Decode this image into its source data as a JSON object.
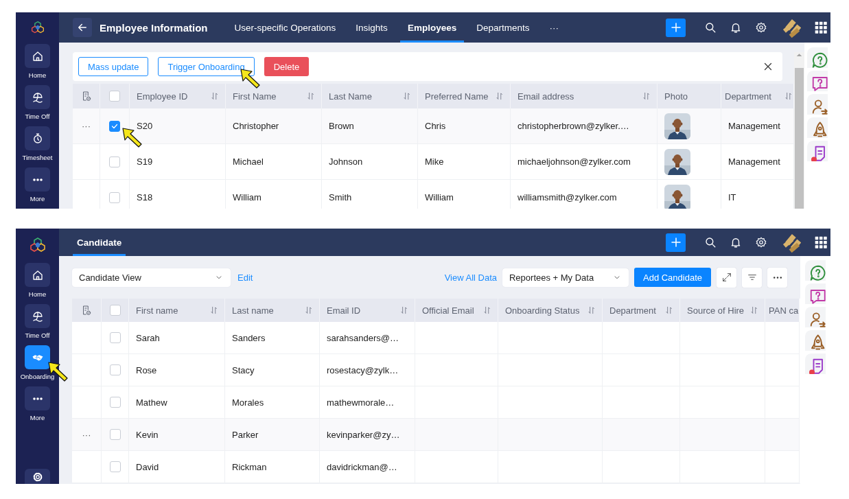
{
  "screens": [
    {
      "sidebar": {
        "items": [
          {
            "kind": "home",
            "label": "Home",
            "selected": false
          },
          {
            "kind": "time-off",
            "label": "Time Off",
            "selected": false
          },
          {
            "kind": "timesheet",
            "label": "Timesheet",
            "selected": false
          },
          {
            "kind": "more",
            "label": "More",
            "selected": false
          }
        ]
      },
      "header": {
        "back_button": true,
        "title": "Employee Information",
        "tabs": [
          {
            "label": "User-specific Operations",
            "selected": false
          },
          {
            "label": "Insights",
            "selected": false
          },
          {
            "label": "Employees",
            "selected": true
          },
          {
            "label": "Departments",
            "selected": false
          },
          {
            "label": "···",
            "selected": false
          }
        ]
      },
      "toolbar": {
        "card": true,
        "left": [
          {
            "kind": "outline-button",
            "label": "Mass update"
          },
          {
            "kind": "outline-button",
            "label": "Trigger Onboarding"
          },
          {
            "kind": "danger-button",
            "label": "Delete"
          }
        ],
        "right": [
          {
            "kind": "close-button"
          }
        ]
      },
      "table": {
        "all_checked": false,
        "columns": [
          {
            "label": "Employee ID",
            "sortable": true
          },
          {
            "label": "First Name",
            "sortable": true
          },
          {
            "label": "Last Name",
            "sortable": true
          },
          {
            "label": "Preferred Name",
            "sortable": true
          },
          {
            "label": "Email address",
            "sortable": true
          },
          {
            "label": "Photo",
            "sortable": false
          },
          {
            "label": "Department",
            "sortable": true
          }
        ],
        "rows": [
          {
            "actions": "···",
            "checked": true,
            "cells": [
              "S20",
              "Christopher",
              "Brown",
              "Chris",
              "christopherbrown@zylker.…",
              {
                "kind": "picture"
              },
              "Management"
            ]
          },
          {
            "checked": false,
            "cells": [
              "S19",
              "Michael",
              "Johnson",
              "Mike",
              "michaeljohnson@zylker.com",
              {
                "kind": "picture"
              },
              "Management"
            ]
          },
          {
            "checked": false,
            "cells": [
              "S18",
              "William",
              "Smith",
              "William",
              "williamsmith@zylker.com",
              {
                "kind": "picture"
              },
              "IT"
            ]
          }
        ]
      }
    },
    {
      "sidebar": {
        "items": [
          {
            "kind": "home",
            "label": "Home",
            "selected": false
          },
          {
            "kind": "time-off",
            "label": "Time Off",
            "selected": false
          },
          {
            "kind": "onboarding",
            "label": "Onboarding",
            "selected": true
          },
          {
            "kind": "more",
            "label": "More",
            "selected": false
          },
          {
            "kind": "gear",
            "selected": false
          }
        ]
      },
      "header": {
        "back_button": false,
        "tabs": [
          {
            "label": "Candidate",
            "selected": true
          }
        ]
      },
      "toolbar": {
        "card": false,
        "left": [
          {
            "kind": "select",
            "value": "Candidate View"
          },
          {
            "kind": "link",
            "label": "Edit"
          }
        ],
        "right": [
          {
            "kind": "link",
            "label": "View All Data"
          },
          {
            "kind": "select",
            "value": "Reportees + My Data"
          },
          {
            "kind": "primary-button",
            "label": "Add Candidate"
          },
          {
            "kind": "expand-button"
          },
          {
            "kind": "filter-button"
          },
          {
            "kind": "more-button"
          }
        ]
      },
      "table": {
        "all_checked": false,
        "columns": [
          {
            "label": "First name",
            "sortable": true
          },
          {
            "label": "Last name",
            "sortable": true
          },
          {
            "label": "Email ID",
            "sortable": true
          },
          {
            "label": "Official Email",
            "sortable": true
          },
          {
            "label": "Onboarding Status",
            "sortable": true
          },
          {
            "label": "Department",
            "sortable": true
          },
          {
            "label": "Source of Hire",
            "sortable": true
          },
          {
            "label": "PAN ca"
          }
        ],
        "rows": [
          {
            "checked": false,
            "cells": [
              "Sarah",
              "Sanders",
              "sarahsanders@…"
            ]
          },
          {
            "checked": false,
            "cells": [
              "Rose",
              "Stacy",
              "rosestacy@zylk…"
            ]
          },
          {
            "checked": false,
            "cells": [
              "Mathew",
              "Morales",
              "mathewmorale…"
            ]
          },
          {
            "actions": "···",
            "checked": false,
            "cells": [
              "Kevin",
              "Parker",
              "kevinparker@zy…"
            ]
          },
          {
            "checked": false,
            "cells": [
              "David",
              "Rickman",
              "davidrickman@…"
            ]
          }
        ]
      }
    }
  ]
}
